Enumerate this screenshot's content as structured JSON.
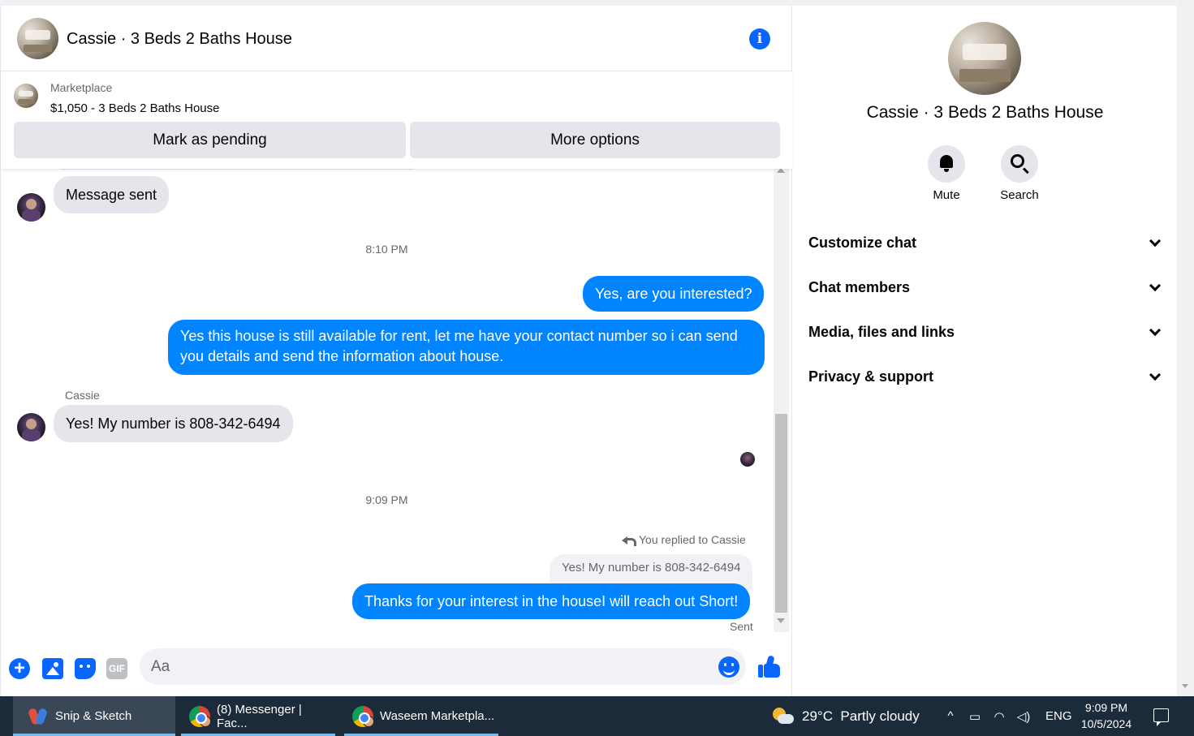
{
  "chat": {
    "title": "Cassie · 3 Beds 2 Baths House",
    "marketplace": {
      "label": "Marketplace",
      "listing": "$1,050 - 3 Beds 2 Baths House",
      "pending_button": "Mark as pending",
      "more_button": "More options"
    },
    "messages": {
      "m1": "Message sent",
      "time1": "8:10 PM",
      "m2": "Yes, are you interested?",
      "m3": "Yes this house is still available for rent, let me have your contact number so i can send you details and send the information about house.",
      "sender": "Cassie",
      "m4": "Yes! My number is 808-342-6494",
      "time2": "9:09 PM",
      "reply_note": "You replied to Cassie",
      "quoted": "Yes! My number is 808-342-6494",
      "m5": "Thanks for your interest in the houseI will reach out Short!",
      "status": "Sent"
    },
    "composer": {
      "placeholder": "Aa",
      "gif_label": "GIF",
      "plus_label": "+"
    },
    "info_glyph": "i"
  },
  "info_panel": {
    "name": "Cassie · 3 Beds 2 Baths House",
    "mute_label": "Mute",
    "search_label": "Search",
    "sections": [
      "Customize chat",
      "Chat members",
      "Media, files and links",
      "Privacy & support"
    ]
  },
  "taskbar": {
    "apps": [
      "Snip & Sketch",
      "(8) Messenger | Fac...",
      "Waseem Marketpla..."
    ],
    "weather": "29°C  Partly cloudy",
    "lang": "ENG",
    "time": "9:09 PM",
    "date": "10/5/2024",
    "tray_glyphs": {
      "chevron": "^",
      "battery": "▭",
      "wifi": "◠",
      "volume": "◁)"
    }
  },
  "colors": {
    "accent": "#0866ff",
    "outgoing_bubble": "#0084ff",
    "incoming_bubble": "#e4e6eb",
    "taskbar": "#1c2b3a"
  }
}
